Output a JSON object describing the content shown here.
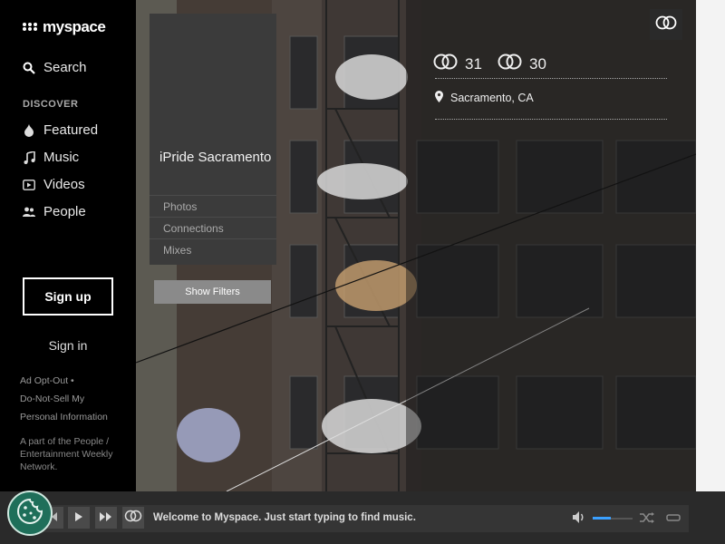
{
  "brand": {
    "name": "myspace"
  },
  "nav": {
    "search_label": "Search",
    "discover_heading": "DISCOVER",
    "items": [
      {
        "label": "Featured",
        "icon": "flame-icon"
      },
      {
        "label": "Music",
        "icon": "music-note-icon"
      },
      {
        "label": "Videos",
        "icon": "video-icon"
      },
      {
        "label": "People",
        "icon": "people-icon"
      }
    ]
  },
  "auth": {
    "signup_label": "Sign up",
    "signin_label": "Sign in"
  },
  "footer": {
    "links": [
      "Ad Opt-Out •",
      "Do-Not-Sell My",
      "Personal Information"
    ],
    "network_note": "A part of the People / Entertainment Weekly Network."
  },
  "profile": {
    "name": "iPride Sacramento",
    "tabs": [
      "Photos",
      "Connections",
      "Mixes"
    ],
    "show_filters_label": "Show Filters",
    "connections_in": "31",
    "connections_out": "30",
    "location": "Sacramento, CA"
  },
  "player": {
    "welcome_text": "Welcome to Myspace. Just start typing to find music.",
    "volume": 0.45
  },
  "colors": {
    "accent": "#3aa0ff",
    "cookie": "#1f6f5a"
  }
}
